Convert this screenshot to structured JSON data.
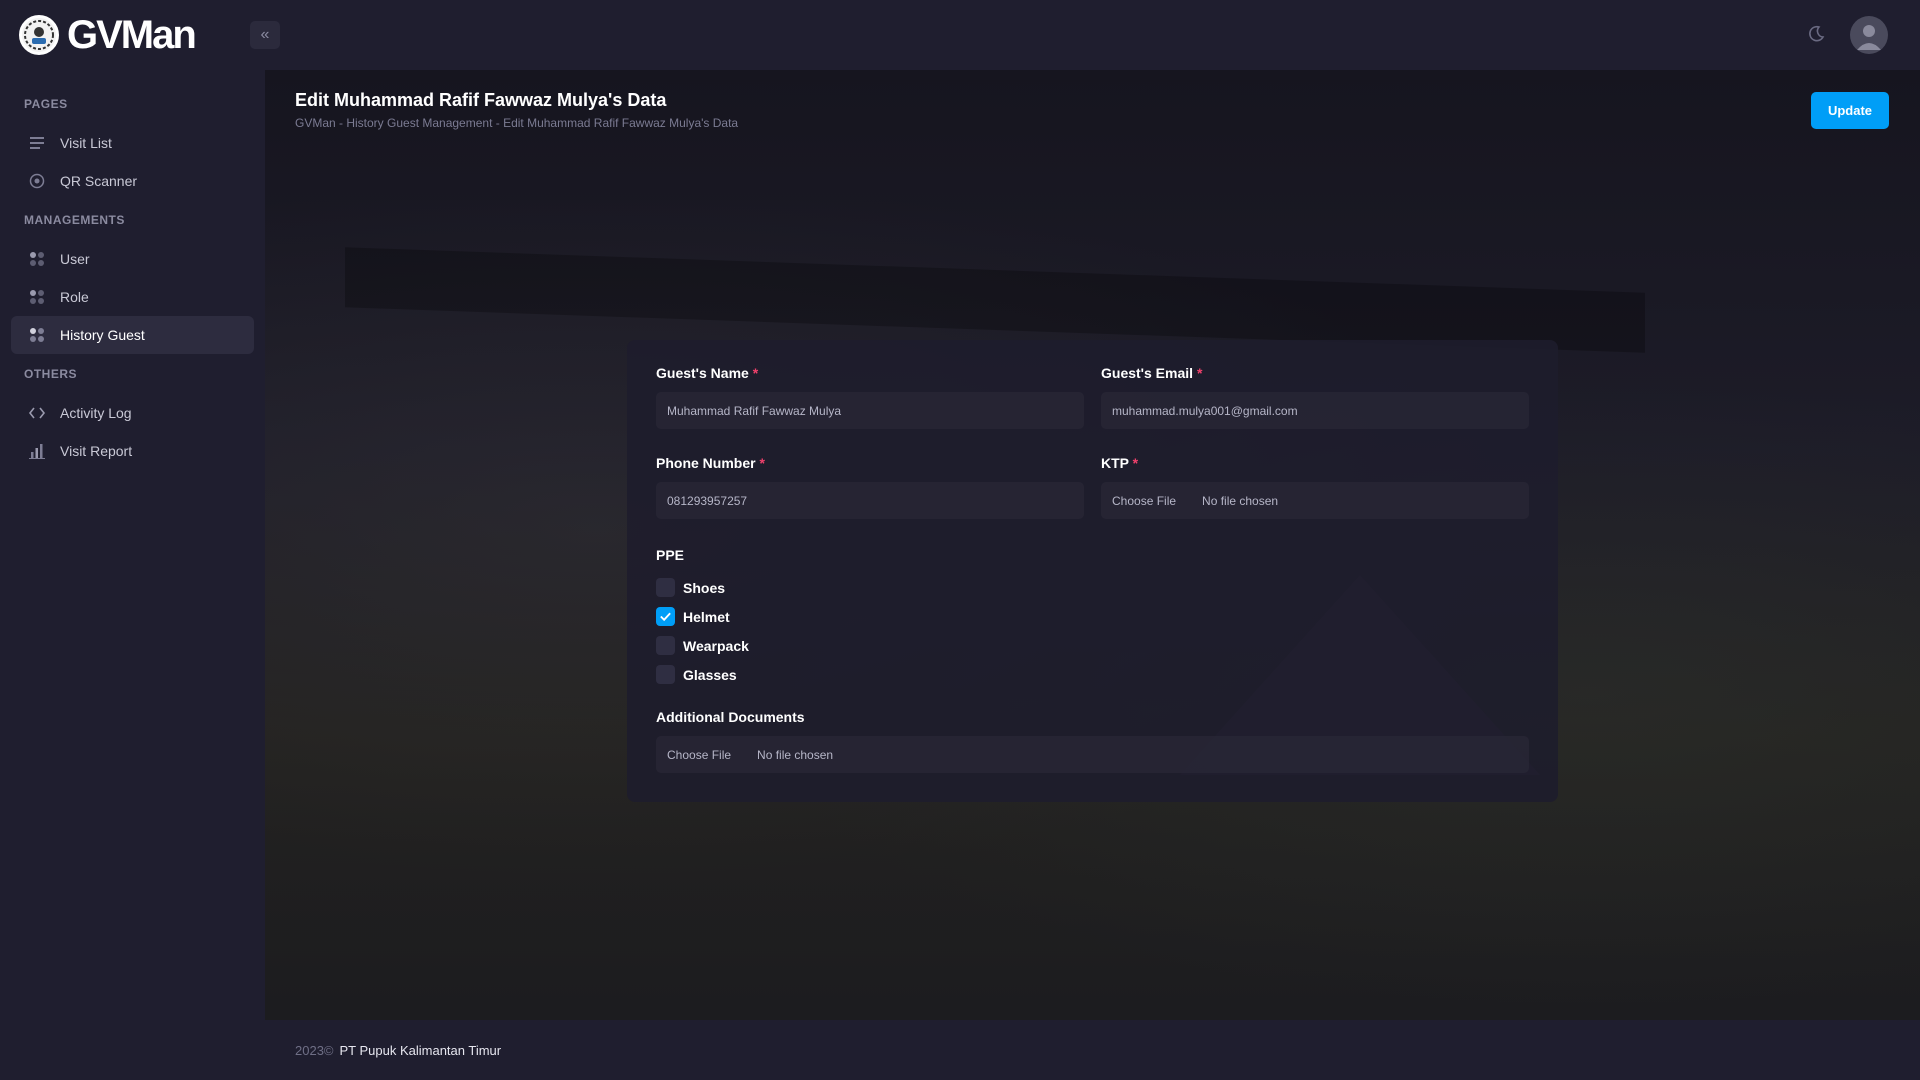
{
  "brand": {
    "name": "GVMan"
  },
  "sidebar": {
    "sections": [
      {
        "title": "PAGES",
        "items": [
          {
            "label": "Visit List",
            "icon": "list-icon"
          },
          {
            "label": "QR Scanner",
            "icon": "target-icon"
          }
        ]
      },
      {
        "title": "MANAGEMENTS",
        "items": [
          {
            "label": "User",
            "icon": "grid-icon"
          },
          {
            "label": "Role",
            "icon": "grid-icon"
          },
          {
            "label": "History Guest",
            "icon": "grid-icon",
            "active": true
          }
        ]
      },
      {
        "title": "OTHERS",
        "items": [
          {
            "label": "Activity Log",
            "icon": "code-icon"
          },
          {
            "label": "Visit Report",
            "icon": "bar-chart-icon"
          }
        ]
      }
    ]
  },
  "page": {
    "title": "Edit Muhammad Rafif Fawwaz Mulya's Data",
    "breadcrumb": "GVMan - History Guest Management - Edit Muhammad Rafif Fawwaz Mulya's Data",
    "update_label": "Update"
  },
  "form": {
    "name_label": "Guest's Name",
    "name_value": "Muhammad Rafif Fawwaz Mulya",
    "email_label": "Guest's Email",
    "email_value": "muhammad.mulya001@gmail.com",
    "phone_label": "Phone Number",
    "phone_value": "081293957257",
    "ktp_label": "KTP",
    "choose_file": "Choose File",
    "no_file": "No file chosen",
    "ppe_label": "PPE",
    "ppe": [
      {
        "label": "Shoes",
        "checked": false
      },
      {
        "label": "Helmet",
        "checked": true
      },
      {
        "label": "Wearpack",
        "checked": false
      },
      {
        "label": "Glasses",
        "checked": false
      }
    ],
    "additional_docs_label": "Additional Documents",
    "required_mark": "*"
  },
  "footer": {
    "year": "2023©",
    "company": "PT Pupuk Kalimantan Timur"
  },
  "colors": {
    "accent": "#009ef7",
    "required": "#f1416c",
    "sidebar_bg": "#1f1e2f"
  }
}
